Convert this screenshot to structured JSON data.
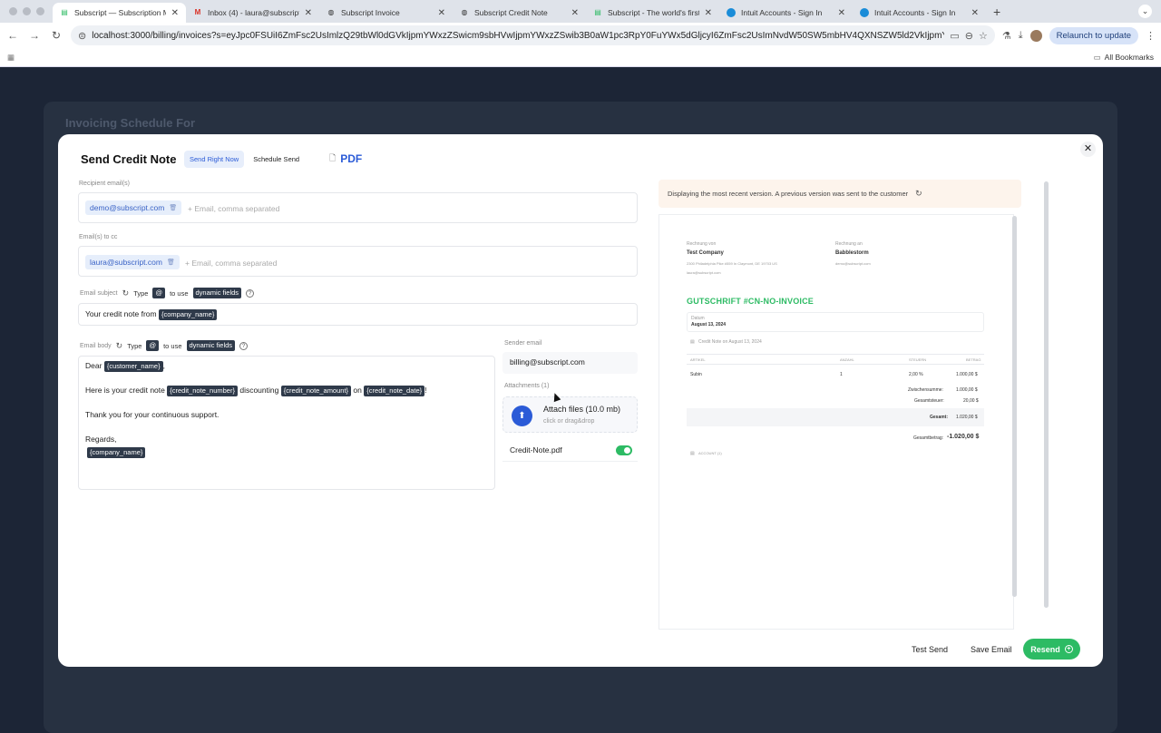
{
  "browser": {
    "tabs": [
      {
        "label": "Subscript — Subscription Ma",
        "icon": "subscript-logo-icon",
        "active": true
      },
      {
        "label": "Inbox (4) - laura@subscript.c",
        "icon": "gmail-icon"
      },
      {
        "label": "Subscript Invoice",
        "icon": "globe-icon"
      },
      {
        "label": "Subscript Credit Note",
        "icon": "globe-icon"
      },
      {
        "label": "Subscript - The world's first c",
        "icon": "subscript-logo-icon"
      },
      {
        "label": "Intuit Accounts - Sign In",
        "icon": "intuit-icon"
      },
      {
        "label": "Intuit Accounts - Sign In",
        "icon": "intuit-icon"
      }
    ],
    "url": "localhost:3000/billing/invoices?s=eyJpc0FSUiI6ZmFsc2UsImlzQ29tbWl0dGVkIjpmYWxzZSwicm9sbHVwIjpmYWxzZSwib3B0aW1pc3RpY0FuYWx5dGljcyI6ZmFsc2UsImNvdW50SW5mbHV4QXNSZW5ld2VkIjpmYWxzZSwiZXhjaGFuZ2VS...",
    "relaunch_label": "Relaunch to update",
    "bookmarks_label": "All Bookmarks"
  },
  "background": {
    "title": "Invoicing Schedule For"
  },
  "modal": {
    "title": "Send Credit Note",
    "send_now_label": "Send Right Now",
    "schedule_label": "Schedule Send",
    "pdf_label": "PDF",
    "recipient_label": "Recipient email(s)",
    "recipient_chip": "demo@subscript.com",
    "email_placeholder": "+ Email, comma separated",
    "cc_label": "Email(s) to cc",
    "cc_chip": "laura@subscript.com",
    "subject_label": "Email subject",
    "type_label": "Type",
    "at_symbol": "@",
    "to_use_label": "to use",
    "dynamic_fields_label": "dynamic fields",
    "subject_prefix": "Your credit note from",
    "subject_tag": "{company_name}",
    "body_label": "Email body",
    "body": {
      "dear": "Dear",
      "customer_tag": "{customer_name}",
      "comma": ",",
      "line2_prefix": "Here is your credit note",
      "cn_number_tag": "{credit_note_number}",
      "discounting": "discounting",
      "cn_amount_tag": "{credit_note_amount}",
      "on": "on",
      "cn_date_tag": "{credit_note_date}",
      "bang": "!",
      "thanks": "Thank you for your continuous support.",
      "regards": "Regards,",
      "company_tag": "{company_name}"
    },
    "sender_label": "Sender email",
    "sender_value": "billing@subscript.com",
    "attachments_label": "Attachments (1)",
    "attach_title": "Attach files (10.0 mb)",
    "attach_sub": "click or drag&drop",
    "file_name": "Credit-Note.pdf",
    "file_enabled": true,
    "notice": "Displaying the most recent version. A previous version was sent to the customer",
    "buttons": {
      "test_send": "Test Send",
      "save_email": "Save Email",
      "resend": "Resend"
    }
  },
  "preview": {
    "from_label": "Rechnung von",
    "from_company": "Test Company",
    "from_address": "2300 Philadelphia Pike #559 In Claymont, DE 19703 US",
    "from_email": "laura@subscript.com",
    "to_label": "Rechnung an",
    "to_company": "Babblestorm",
    "to_email": "demo@subscript.com",
    "doc_title": "GUTSCHRIFT #CN-NO-INVOICE",
    "date_label": "Datum",
    "date_value": "August 13, 2024",
    "memo": "Credit Note on August 13, 2024",
    "col_item": "ARTIKEL",
    "col_qty": "ANZAHL",
    "col_tax": "STEUERN",
    "col_amount": "BETRAG",
    "row_item": "Subin",
    "row_qty": "1",
    "row_tax": "2,00 %",
    "row_amount": "1.000,00 $",
    "subtotal_label": "Zwischensumme:",
    "subtotal_value": "1.000,00 $",
    "total_tax_label": "Gesamtsteuer:",
    "total_tax_value": "20,00 $",
    "total_label": "Gesamt:",
    "total_value": "1.020,00 $",
    "grand_label": "Gesamtbetrag:",
    "grand_value": "-1.020,00 $",
    "account_label": "ACCOUNT (1)"
  },
  "colors": {
    "accent": "#2b5bd7",
    "success": "#2dbb64",
    "tag_bg": "#2f3a4a"
  }
}
